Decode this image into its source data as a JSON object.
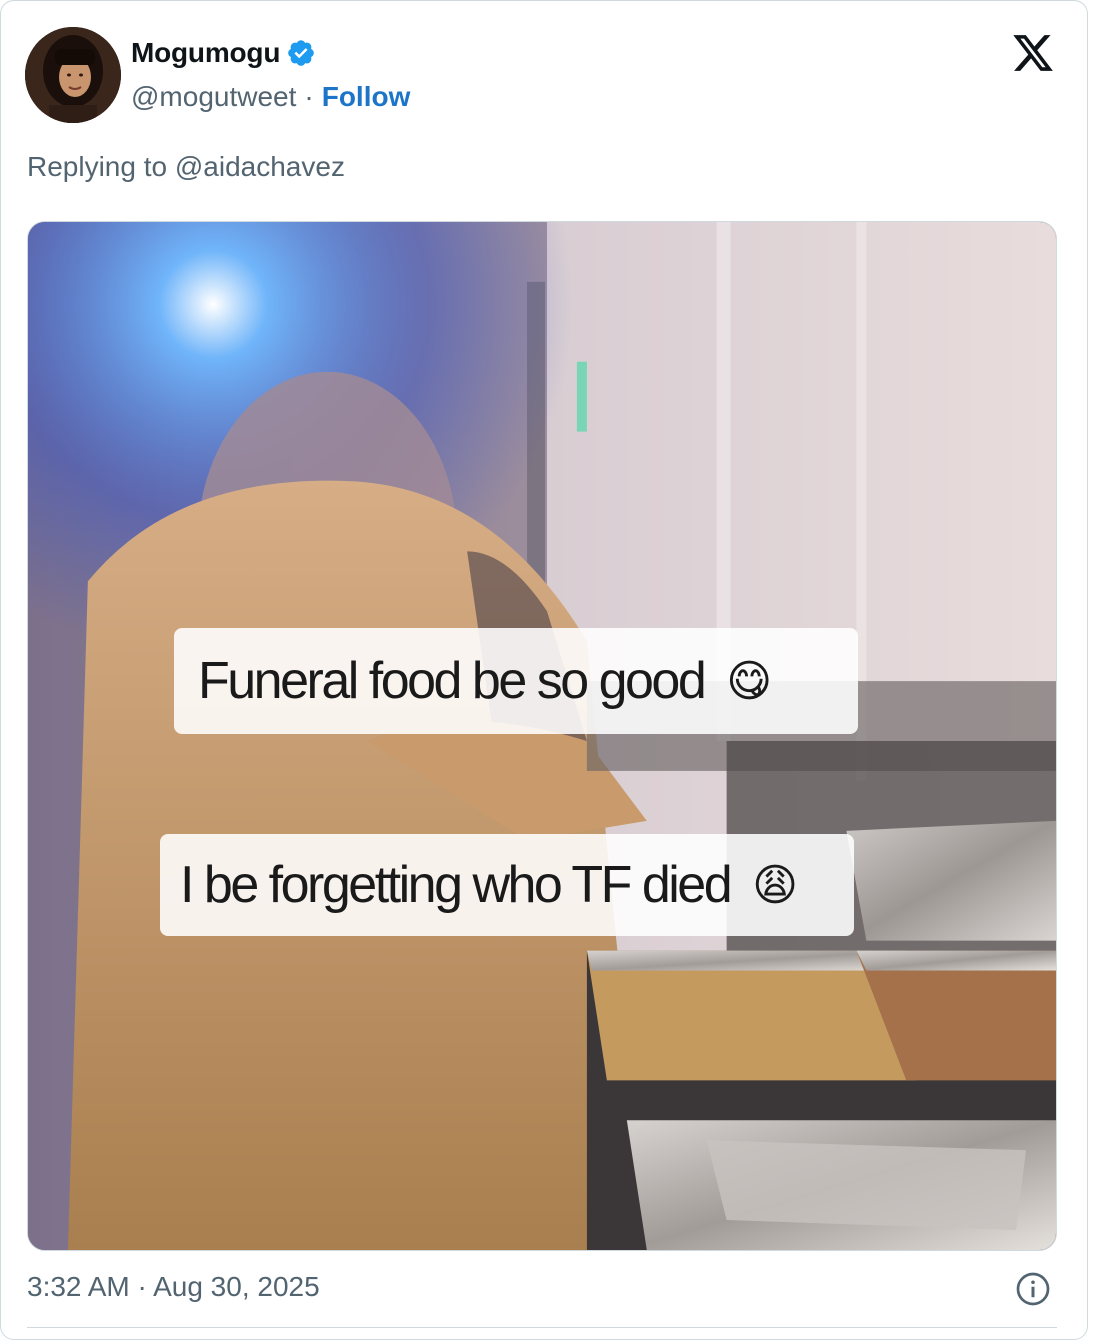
{
  "tweet": {
    "display_name": "Mogumogu",
    "handle": "@mogutweet",
    "separator": "·",
    "follow_label": "Follow",
    "replying_prefix": "Replying to",
    "replying_to": "@aidachavez",
    "timestamp": "3:32 AM · Aug 30, 2025"
  },
  "media": {
    "caption_1": "Funeral food be so good",
    "caption_1_emoji": "😋",
    "caption_2": "I be forgetting who TF died",
    "caption_2_emoji": "😩"
  },
  "icons": {
    "verified": "verified-badge-icon",
    "logo": "x-logo-icon",
    "info": "info-icon"
  },
  "colors": {
    "verified_blue": "#1d9bf0",
    "follow_blue": "#1d75c9",
    "secondary_text": "#536471",
    "border": "#cfd9de"
  }
}
